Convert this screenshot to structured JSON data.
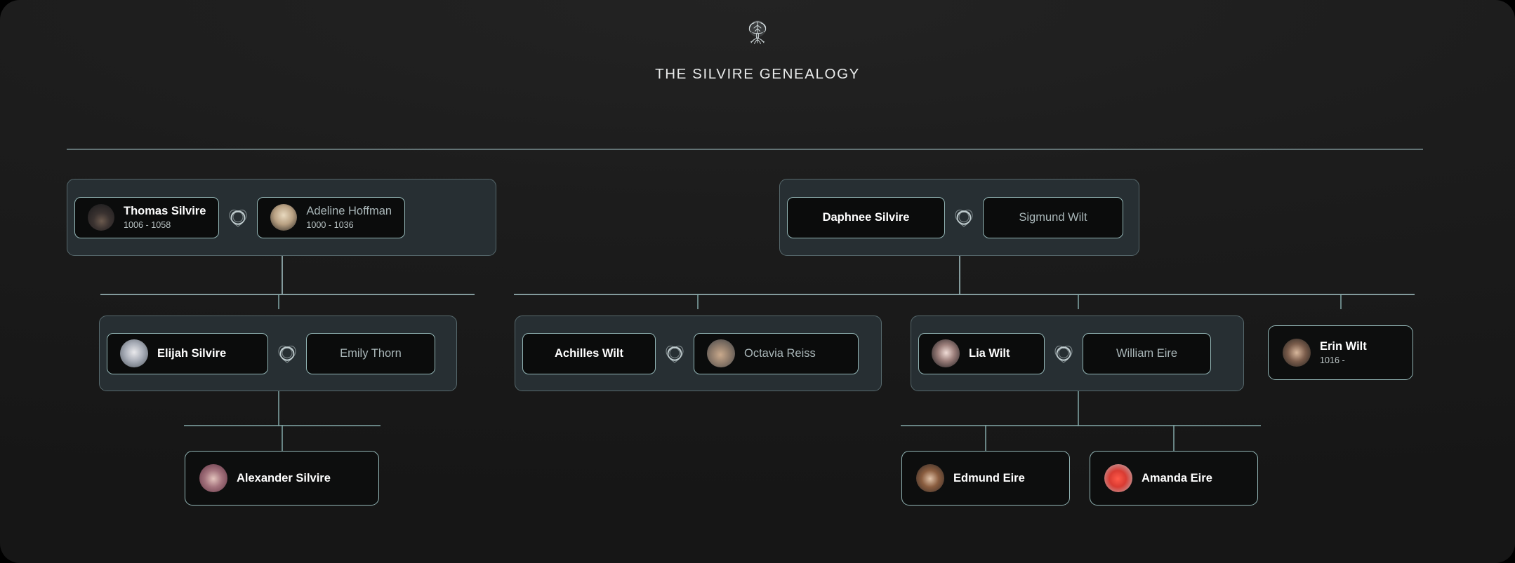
{
  "header": {
    "logo_icon": "family-tree-icon",
    "title": "THE SILVIRE GENEALOGY"
  },
  "icons": {
    "marriage": "interlocking-rings-marriage-icon"
  },
  "colors": {
    "page_background": "#1a1a1a",
    "couple_frame": "#272f33",
    "couple_border": "#56688c",
    "card_background": "#0b0c0c",
    "card_border": "#93b6b6",
    "connector": "#a9c4c6",
    "bloodline_name": "#ffffff",
    "spouse_name": "#a9b6b8",
    "dates": "#b9c3c4"
  },
  "generations": [
    {
      "label": "generation-1",
      "couples": [
        {
          "id": "thomas-adeline",
          "left": {
            "name": "Thomas Silvire",
            "dates": "1006 - 1058",
            "role": "bloodline",
            "avatar": "av-thomas",
            "has_avatar": true
          },
          "right": {
            "name": "Adeline Hoffman",
            "dates": "1000 - 1036",
            "role": "spouse",
            "avatar": "av-adeline",
            "has_avatar": true
          }
        },
        {
          "id": "daphnee-sigmund",
          "left": {
            "name": "Daphnee Silvire",
            "dates": "",
            "role": "bloodline",
            "avatar": "",
            "has_avatar": false
          },
          "right": {
            "name": "Sigmund Wilt",
            "dates": "",
            "role": "spouse",
            "avatar": "",
            "has_avatar": false
          }
        }
      ]
    },
    {
      "label": "generation-2",
      "couples": [
        {
          "id": "elijah-emily",
          "left": {
            "name": "Elijah Silvire",
            "dates": "",
            "role": "bloodline",
            "avatar": "av-elijah",
            "has_avatar": true
          },
          "right": {
            "name": "Emily Thorn",
            "dates": "",
            "role": "spouse",
            "avatar": "",
            "has_avatar": false
          }
        },
        {
          "id": "achilles-octavia",
          "left": {
            "name": "Achilles Wilt",
            "dates": "",
            "role": "bloodline",
            "avatar": "",
            "has_avatar": false
          },
          "right": {
            "name": "Octavia Reiss",
            "dates": "",
            "role": "spouse",
            "avatar": "av-octavia",
            "has_avatar": true
          }
        },
        {
          "id": "lia-william",
          "left": {
            "name": "Lia Wilt",
            "dates": "",
            "role": "bloodline",
            "avatar": "av-lia",
            "has_avatar": true
          },
          "right": {
            "name": "William Eire",
            "dates": "",
            "role": "spouse",
            "avatar": "",
            "has_avatar": false
          }
        }
      ],
      "singles": [
        {
          "id": "erin",
          "name": "Erin Wilt",
          "dates": "1016 -",
          "role": "bloodline",
          "avatar": "av-erin",
          "has_avatar": true
        }
      ]
    },
    {
      "label": "generation-3",
      "singles": [
        {
          "id": "alexander",
          "name": "Alexander Silvire",
          "dates": "",
          "role": "bloodline",
          "avatar": "av-alex",
          "has_avatar": true
        },
        {
          "id": "edmund",
          "name": "Edmund Eire",
          "dates": "",
          "role": "bloodline",
          "avatar": "av-edmund",
          "has_avatar": true
        },
        {
          "id": "amanda",
          "name": "Amanda Eire",
          "dates": "",
          "role": "bloodline",
          "avatar": "av-amanda",
          "has_avatar": true
        }
      ]
    }
  ]
}
